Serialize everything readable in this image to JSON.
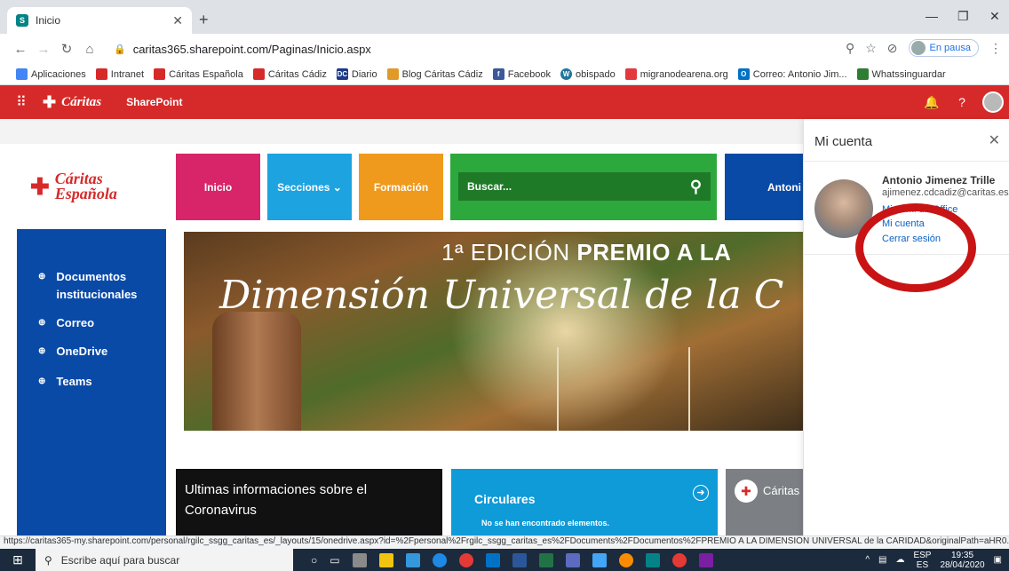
{
  "browser": {
    "tab_title": "Inicio",
    "url": "caritas365.sharepoint.com/Paginas/Inicio.aspx",
    "paused_label": "En pausa",
    "status_url": "https://caritas365-my.sharepoint.com/personal/rgilc_ssgg_caritas_es/_layouts/15/onedrive.aspx?id=%2Fpersonal%2Frgilc_ssgg_caritas_es%2FDocuments%2FDocumentos%2FPREMIO A LA DIMENSIÓN UNIVERSAL de la CARIDAD&originalPath=aHR0..."
  },
  "bookmarks": [
    {
      "label": "Aplicaciones",
      "color": "#4285f4"
    },
    {
      "label": "Intranet",
      "color": "#d62a2a"
    },
    {
      "label": "Cáritas Española",
      "color": "#d62a2a"
    },
    {
      "label": "Cáritas Cádiz",
      "color": "#d62a2a"
    },
    {
      "label": "Diario",
      "color": "#1b3a8a"
    },
    {
      "label": "Blog Cáritas Cádiz",
      "color": "#e09a2a"
    },
    {
      "label": "Facebook",
      "color": "#3b5998"
    },
    {
      "label": "obispado",
      "color": "#21759b"
    },
    {
      "label": "migranodearena.org",
      "color": "#e2383f"
    },
    {
      "label": "Correo: Antonio Jim...",
      "color": "#0072c6"
    },
    {
      "label": "Whatssinguardar",
      "color": "#2e7d32"
    }
  ],
  "suite": {
    "brand": "Cáritas",
    "app": "SharePoint"
  },
  "page": {
    "logo_line1": "Cáritas",
    "logo_line2": "Española",
    "tiles": [
      "Inicio",
      "Secciones ⌄",
      "Formación"
    ],
    "search_placeholder": "Buscar...",
    "partial_tile": "Antoni",
    "nav_items": [
      "Documentos institucionales",
      "Correo",
      "OneDrive",
      "Teams"
    ],
    "banner_line1_pre": "1ª EDICIÓN ",
    "banner_line1_bold": "PREMIO A LA",
    "banner_line2": "Dimensión Universal de la C",
    "card1": "Ultimas informaciones sobre el Coronavirus",
    "card2_title": "Circulares",
    "card2_msg": "No se han encontrado elementos.",
    "card3_title": "Cáritas"
  },
  "account": {
    "title": "Mi cuenta",
    "name": "Antonio Jimenez Trille",
    "email": "ajimenez.cdcadiz@caritas.es",
    "links": [
      "Mi perfil de Office",
      "Mi cuenta",
      "Cerrar sesión"
    ]
  },
  "taskbar": {
    "search": "Escribe aquí para buscar",
    "lang1": "ESP",
    "lang2": "ES",
    "time": "19:35",
    "date": "28/04/2020"
  }
}
